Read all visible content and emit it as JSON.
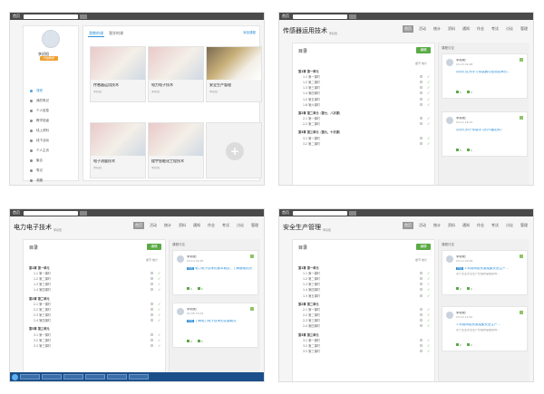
{
  "common": {
    "home_label": "首页"
  },
  "p1": {
    "user": {
      "name": "李初阳",
      "badge": "升级教学"
    },
    "sidebar": [
      "课程",
      "我的笔记",
      "个人信息",
      "教学班级",
      "线上资料",
      "线下活动",
      "个人主页",
      "聚合",
      "笔记",
      "收藏"
    ],
    "tabs": {
      "tab1": "我教的课",
      "tab2": "我学的课"
    },
    "tab_right": "添加课程",
    "courses": [
      {
        "title": "传感器运用技术",
        "sub": "李初阳"
      },
      {
        "title": "电力电子技术",
        "sub": "李初阳"
      },
      {
        "title": "安全生产管理",
        "sub": "李初阳"
      },
      {
        "title": "电子测量技术",
        "sub": "李初阳"
      },
      {
        "title": "楼宇智能化工程技术",
        "sub": "李初阳"
      }
    ]
  },
  "nav": [
    "首页",
    "活动",
    "统计",
    "资料",
    "通知",
    "作业",
    "考试",
    "讨论",
    "管理"
  ],
  "outline_labels": {
    "title": "目录",
    "edit": "编辑",
    "header": "章节  统计",
    "discussion": "课程讨论"
  },
  "p2": {
    "title": "传感器运用技术",
    "sub": "李初阳",
    "chapters": [
      {
        "name": "第1章 第一单元",
        "sections": [
          "1.1 第一课时",
          "1.2 第二课时",
          "1.3 第三课时",
          "1.4 第四课时",
          "1.5 第五课时",
          "1.6 第六课时"
        ]
      },
      {
        "name": "第2章 第二单元（第七、八次课）",
        "sections": [
          "2.1 第一课时",
          "2.2 第二课时"
        ]
      },
      {
        "name": "第3章 第三单元（第九、十次课）",
        "sections": [
          "3.1 第一课时",
          "3.2 第二课时"
        ]
      }
    ],
    "posts": [
      {
        "name": "李初阳",
        "date": "03-15 09:48",
        "text": "同学们认为学习传感器与检测技术的...",
        "sub": "",
        "likes": "0",
        "replies": "0"
      },
      {
        "name": "李初阳",
        "date": "03-12 18:15",
        "text": "同学们对于传感学习的兴趣如何？",
        "sub": "",
        "likes": "0",
        "replies": "0"
      }
    ]
  },
  "p3": {
    "title": "电力电子技术",
    "sub": "李初阳",
    "chapters": [
      {
        "name": "第1章 第一单元",
        "sections": [
          "1.1 第一课时",
          "1.2 第二课时",
          "1.3 第三课时",
          "1.4 第四课时"
        ]
      },
      {
        "name": "第2章 第二单元",
        "sections": [
          "2.1 第一课时",
          "2.2 第二课时",
          "2.3 第三课时",
          "2.4 第四课时"
        ]
      },
      {
        "name": "第3章 第三单元",
        "sections": [
          "3.1 第一课时",
          "3.2 第二课时",
          "3.3 第三课时"
        ]
      }
    ],
    "posts": [
      {
        "name": "李初阳",
        "date": "03-10 09:48",
        "tag": "讨论",
        "text": "电力电子技术的基本概念，了解基础知识",
        "likes": "0",
        "replies": "0"
      },
      {
        "name": "李初阳",
        "date": "03-08 15:02",
        "tag": "讨论",
        "text": "了解电力电子技术的发展概况",
        "likes": "0",
        "replies": "0"
      }
    ]
  },
  "p4": {
    "title": "安全生产管理",
    "sub": "李初阳",
    "chapters": [
      {
        "name": "第1章 第一单元",
        "sections": [
          "1.1 第一课时",
          "1.2 第二课时",
          "1.3 第三课时",
          "1.4 第四课时",
          "1.5 第五课时"
        ]
      },
      {
        "name": "第2章 第二单元",
        "sections": [
          "2.1 第一课时",
          "2.2 第二课时",
          "2.3 第三课时",
          "2.4 第四课时"
        ]
      },
      {
        "name": "第3章 第三单元",
        "sections": [
          "3.1 第一课时",
          "3.2 第二课时",
          "3.3 第三课时"
        ]
      }
    ],
    "posts": [
      {
        "name": "李初阳",
        "date": "03-12 09:48",
        "tag": "讨论",
        "text": "1.利用网络资源搜集安全生产...",
        "sub": "关于企业安全生产管理的事故案例...",
        "likes": "0",
        "replies": "0"
      },
      {
        "name": "李初阳",
        "date": "03-10 14:20",
        "tag": "",
        "text": "1.利用网络资源搜集安全生产...",
        "sub": "关于企业安全生产管理的事故案例...",
        "likes": "0",
        "replies": "0"
      }
    ]
  }
}
